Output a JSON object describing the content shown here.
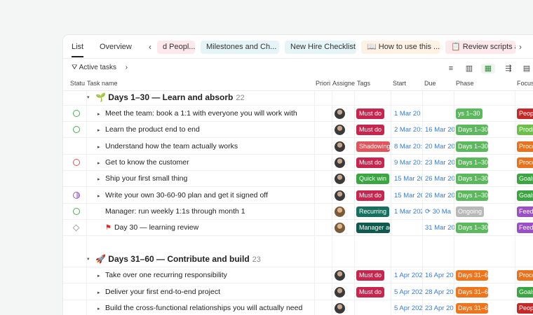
{
  "tabs": {
    "list": "List",
    "overview": "Overview",
    "chips": [
      {
        "label": "d Peopl...",
        "bg": "#fde8ec"
      },
      {
        "label": "Milestones and Ch...",
        "bg": "#e5f4f6"
      },
      {
        "label": "New Hire Checklist",
        "bg": "#e5f4f6"
      },
      {
        "label": "📖 How to use this ...",
        "bg": "#fdf2e3"
      },
      {
        "label": "📋 Review scripts a",
        "bg": "#fde8ec"
      }
    ],
    "prev_arrow": "‹",
    "next_arrow": "›"
  },
  "toolbar": {
    "filter_label": "Active tasks",
    "filter_icon": "funnel-icon",
    "expand_icon": "chevron-right-icon"
  },
  "columns": {
    "status": "Statu",
    "task": "Task name",
    "priority": "Priori",
    "assignee": "Assigne",
    "tags": "Tags",
    "start": "Start",
    "due": "Due",
    "phase": "Phase",
    "focus": "Focus"
  },
  "groups": [
    {
      "icon": "🌱",
      "title": "Days 1–30 — Learn and absorb",
      "count": "22",
      "rows": [
        {
          "status": "green",
          "task": "Meet the team: book a 1:1 with everyone you will work with",
          "caret": true,
          "avatar": "a",
          "tag": "Must do",
          "tag_color": "#c7254e",
          "start": "1 Mar 20",
          "due": "",
          "phase": "ys 1–30",
          "phase_color": "#5cb85c",
          "focus": "Peop",
          "focus_color": "#c62828"
        },
        {
          "status": "green",
          "task": "Learn the product end to end",
          "caret": true,
          "avatar": "a",
          "tag": "Must do",
          "tag_color": "#c7254e",
          "start": "2 Mar 20:",
          "due": "16 Mar 20",
          "phase": "Days 1–30",
          "phase_color": "#5cb85c",
          "focus": "Prodi",
          "focus_color": "#6cc04a"
        },
        {
          "status": "none",
          "task": "Understand how the team actually works",
          "caret": true,
          "avatar": "a",
          "tag": "Shadowing",
          "tag_color": "#e0555b",
          "start": "8 Mar 20:",
          "due": "20 Mar 20",
          "phase": "Days 1–30",
          "phase_color": "#5cb85c",
          "focus": "Proce",
          "focus_color": "#e8731c"
        },
        {
          "status": "red",
          "task": "Get to know the customer",
          "caret": true,
          "avatar": "a",
          "tag": "Must do",
          "tag_color": "#c7254e",
          "start": "9 Mar 20:",
          "due": "23 Mar 20",
          "phase": "Days 1–30",
          "phase_color": "#5cb85c",
          "focus": "Proce",
          "focus_color": "#e8731c"
        },
        {
          "status": "none",
          "task": "Ship your first small thing",
          "caret": true,
          "avatar": "a",
          "tag": "Quick win",
          "tag_color": "#3aa541",
          "start": "15 Mar 2C",
          "due": "26 Mar 20",
          "phase": "Days 1–30",
          "phase_color": "#5cb85c",
          "focus": "Goals",
          "focus_color": "#3aa541"
        },
        {
          "status": "purple",
          "task": "Write your own 30-60-90 plan and get it signed off",
          "caret": true,
          "avatar": "a",
          "tag": "Must do",
          "tag_color": "#c7254e",
          "start": "15 Mar 2C",
          "due": "26 Mar 20",
          "phase": "Days 1–30",
          "phase_color": "#5cb85c",
          "focus": "Goals",
          "focus_color": "#3aa541"
        },
        {
          "status": "green",
          "task": "Manager: run weekly 1:1s through month 1",
          "caret": false,
          "avatar": "b",
          "tag": "Recurring",
          "tag_color": "#17705f",
          "start": "1 Mar 202",
          "due": "⟳ 30 Ma",
          "phase": "Ongoing",
          "phase_color": "#b8b8b8",
          "focus": "Feed",
          "focus_color": "#9b4fc7"
        },
        {
          "status": "diamond",
          "task": "Day 30 — learning review",
          "caret": false,
          "flag": true,
          "avatar": "b",
          "tag": "Manager ac",
          "tag_color": "#0f5a4c",
          "start": "",
          "due": "31 Mar 20",
          "phase": "Days 1–30",
          "phase_color": "#5cb85c",
          "focus": "Feed",
          "focus_color": "#9b4fc7"
        }
      ]
    },
    {
      "icon": "🚀",
      "title": "Days 31–60 — Contribute and build",
      "count": "23",
      "rows": [
        {
          "status": "none",
          "task": "Take over one recurring responsibility",
          "caret": true,
          "avatar": "a",
          "tag": "Must do",
          "tag_color": "#c7254e",
          "start": "1 Apr 202",
          "due": "16 Apr 20",
          "phase": "Days 31–60",
          "phase_color": "#f0751a",
          "focus": "Proce",
          "focus_color": "#e8731c"
        },
        {
          "status": "none",
          "task": "Deliver your first end-to-end project",
          "caret": true,
          "avatar": "a",
          "tag": "Must do",
          "tag_color": "#c7254e",
          "start": "5 Apr 202",
          "due": "28 Apr 20",
          "phase": "Days 31–60",
          "phase_color": "#f0751a",
          "focus": "Goals",
          "focus_color": "#3aa541"
        },
        {
          "status": "none",
          "task": "Build the cross-functional relationships you will actually need",
          "caret": true,
          "avatar": "a",
          "tag": "",
          "tag_color": "",
          "start": "5 Apr 202",
          "due": "23 Apr 20",
          "phase": "Days 31–60",
          "phase_color": "#f0751a",
          "focus": "Peop",
          "focus_color": "#c62828"
        }
      ]
    }
  ]
}
